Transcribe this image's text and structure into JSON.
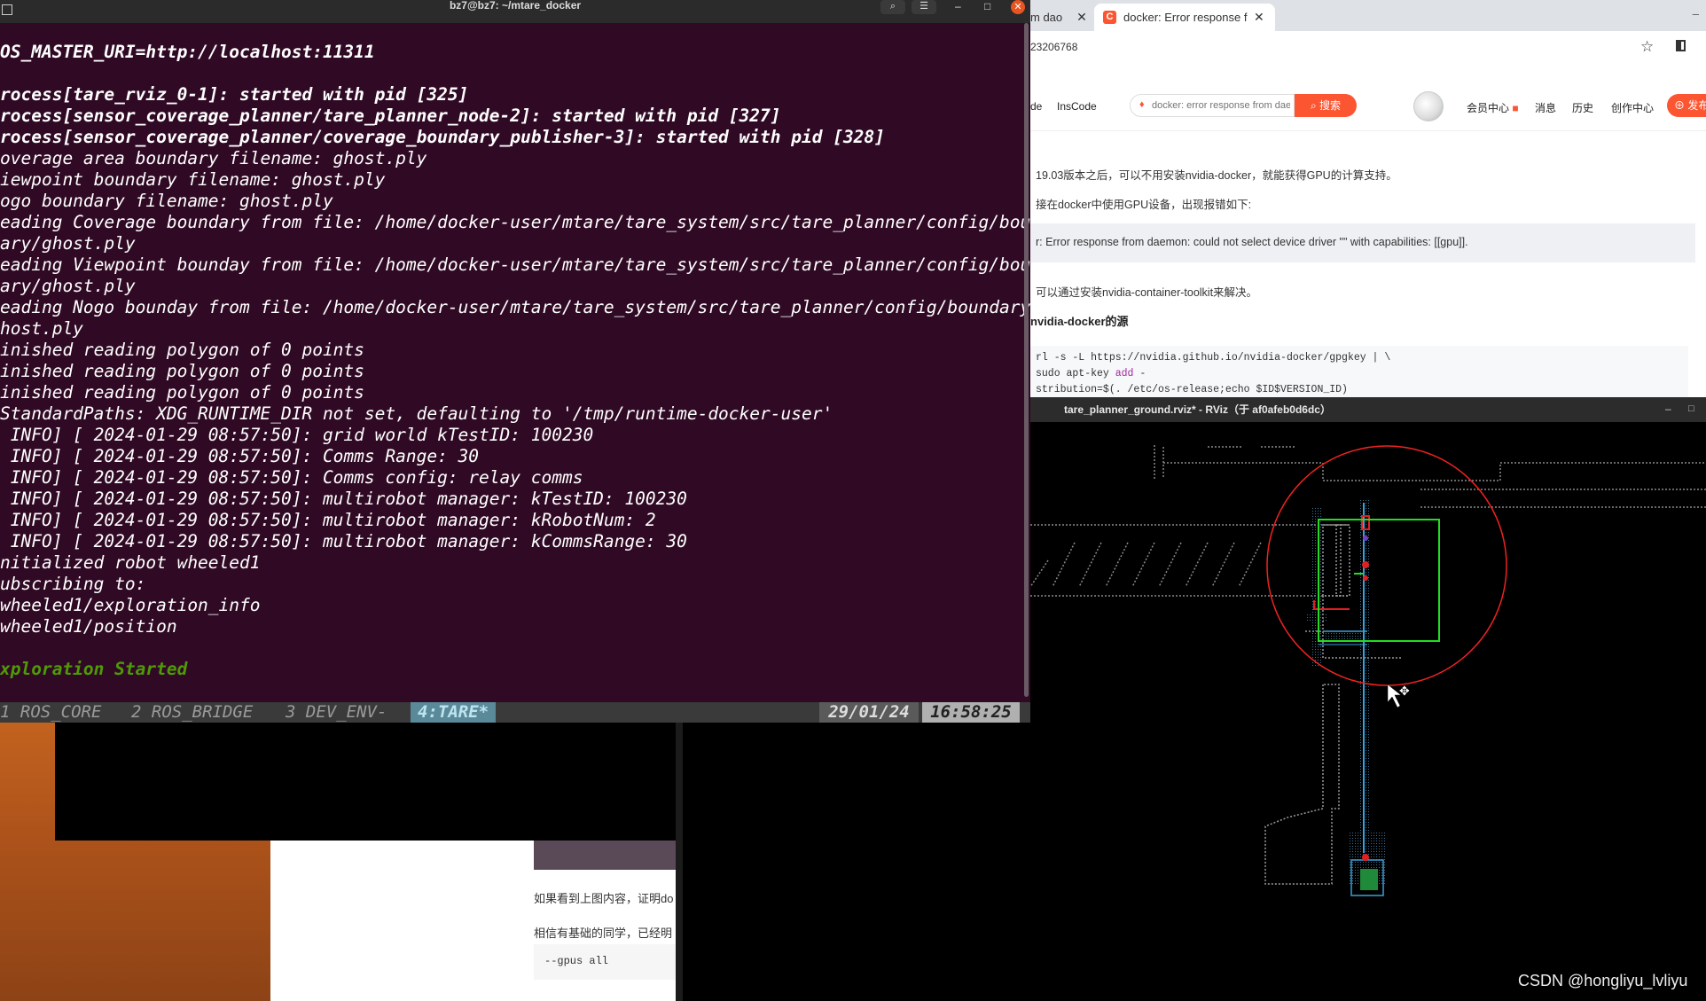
{
  "terminal": {
    "title": "bz7@bz7: ~/mtare_docker",
    "lines": [
      {
        "text": "OS_MASTER_URI=http://localhost:11311",
        "style": "bold"
      },
      {
        "text": "",
        "style": ""
      },
      {
        "text": "rocess[tare_rviz_0-1]: started with pid [325]",
        "style": "bold"
      },
      {
        "text": "rocess[sensor_coverage_planner/tare_planner_node-2]: started with pid [327]",
        "style": "bold"
      },
      {
        "text": "rocess[sensor_coverage_planner/coverage_boundary_publisher-3]: started with pid [328]",
        "style": "bold"
      },
      {
        "text": "overage area boundary filename: ghost.ply",
        "style": ""
      },
      {
        "text": "iewpoint boundary filename: ghost.ply",
        "style": ""
      },
      {
        "text": "ogo boundary filename: ghost.ply",
        "style": ""
      },
      {
        "text": "eading Coverage boundary from file: /home/docker-user/mtare/tare_system/src/tare_planner/config/boun",
        "style": ""
      },
      {
        "text": "ary/ghost.ply",
        "style": ""
      },
      {
        "text": "eading Viewpoint bounday from file: /home/docker-user/mtare/tare_system/src/tare_planner/config/boun",
        "style": ""
      },
      {
        "text": "ary/ghost.ply",
        "style": ""
      },
      {
        "text": "eading Nogo bounday from file: /home/docker-user/mtare/tare_system/src/tare_planner/config/boundary/",
        "style": ""
      },
      {
        "text": "host.ply",
        "style": ""
      },
      {
        "text": "inished reading polygon of 0 points",
        "style": ""
      },
      {
        "text": "inished reading polygon of 0 points",
        "style": ""
      },
      {
        "text": "inished reading polygon of 0 points",
        "style": ""
      },
      {
        "text": "StandardPaths: XDG_RUNTIME_DIR not set, defaulting to '/tmp/runtime-docker-user'",
        "style": ""
      },
      {
        "text": " INFO] [ 2024-01-29 08:57:50]: grid world kTestID: 100230",
        "style": ""
      },
      {
        "text": " INFO] [ 2024-01-29 08:57:50]: Comms Range: 30",
        "style": ""
      },
      {
        "text": " INFO] [ 2024-01-29 08:57:50]: Comms config: relay comms",
        "style": ""
      },
      {
        "text": " INFO] [ 2024-01-29 08:57:50]: multirobot manager: kTestID: 100230",
        "style": ""
      },
      {
        "text": " INFO] [ 2024-01-29 08:57:50]: multirobot manager: kRobotNum: 2",
        "style": ""
      },
      {
        "text": " INFO] [ 2024-01-29 08:57:50]: multirobot manager: kCommsRange: 30",
        "style": ""
      },
      {
        "text": "nitialized robot wheeled1",
        "style": ""
      },
      {
        "text": "ubscribing to:",
        "style": ""
      },
      {
        "text": "wheeled1/exploration_info",
        "style": ""
      },
      {
        "text": "wheeled1/position",
        "style": ""
      },
      {
        "text": "",
        "style": ""
      },
      {
        "text": "xploration Started",
        "style": "green"
      }
    ],
    "status_windows": [
      "1 ROS_CORE",
      "2 ROS_BRIDGE",
      "3 DEV_ENV-",
      "4:TARE*"
    ],
    "status_date": "29/01/24",
    "status_time": "16:58:25"
  },
  "browser": {
    "prev_tab_label": "m dao",
    "active_tab_title": "docker: Error response f",
    "tab_favicon_letter": "C",
    "url_fragment": "23206768",
    "nav": {
      "de": "de",
      "inscode": "InsCode",
      "search_placeholder": "docker: error response from daemon",
      "search_button": "搜索",
      "member_center": "会员中心",
      "messages": "消息",
      "history": "历史",
      "creator_center": "创作中心",
      "publish": "发布"
    },
    "article": {
      "p1": "19.03版本之后，可以不用安装nvidia-docker，就能获得GPU的计算支持。",
      "p2": "接在docker中使用GPU设备，出现报错如下:",
      "quote": "r: Error response from daemon: could not select device driver \"\" with capabilities: [[gpu]].",
      "p3": "可以通过安装nvidia-container-toolkit来解决。",
      "heading": "nvidia-docker的源",
      "code1": "rl -s -L https://nvidia.github.io/nvidia-docker/gpgkey | \\",
      "code2_a": "sudo apt-key ",
      "code2_kw": "add",
      "code2_b": " -",
      "code3": "stribution=$(. /etc/os-release;echo $ID$VERSION_ID)"
    }
  },
  "rviz": {
    "title": "tare_planner_ground.rviz* - RViz（于 af0afeb0d6dc）"
  },
  "background_browser": {
    "line1": "如果看到上图内容，证明do",
    "line2": "相信有基础的同学，已经明",
    "code": "--gpus all"
  },
  "watermark": "CSDN @hongliyu_lvliyu",
  "colors": {
    "terminal_bg": "#300a24",
    "csdn_red": "#fc5531",
    "rviz_frontier_green": "#22dd22",
    "rviz_range_red": "#ee2222",
    "rviz_path_blue": "#3aa0d8",
    "ubuntu_orange": "#e95420"
  }
}
